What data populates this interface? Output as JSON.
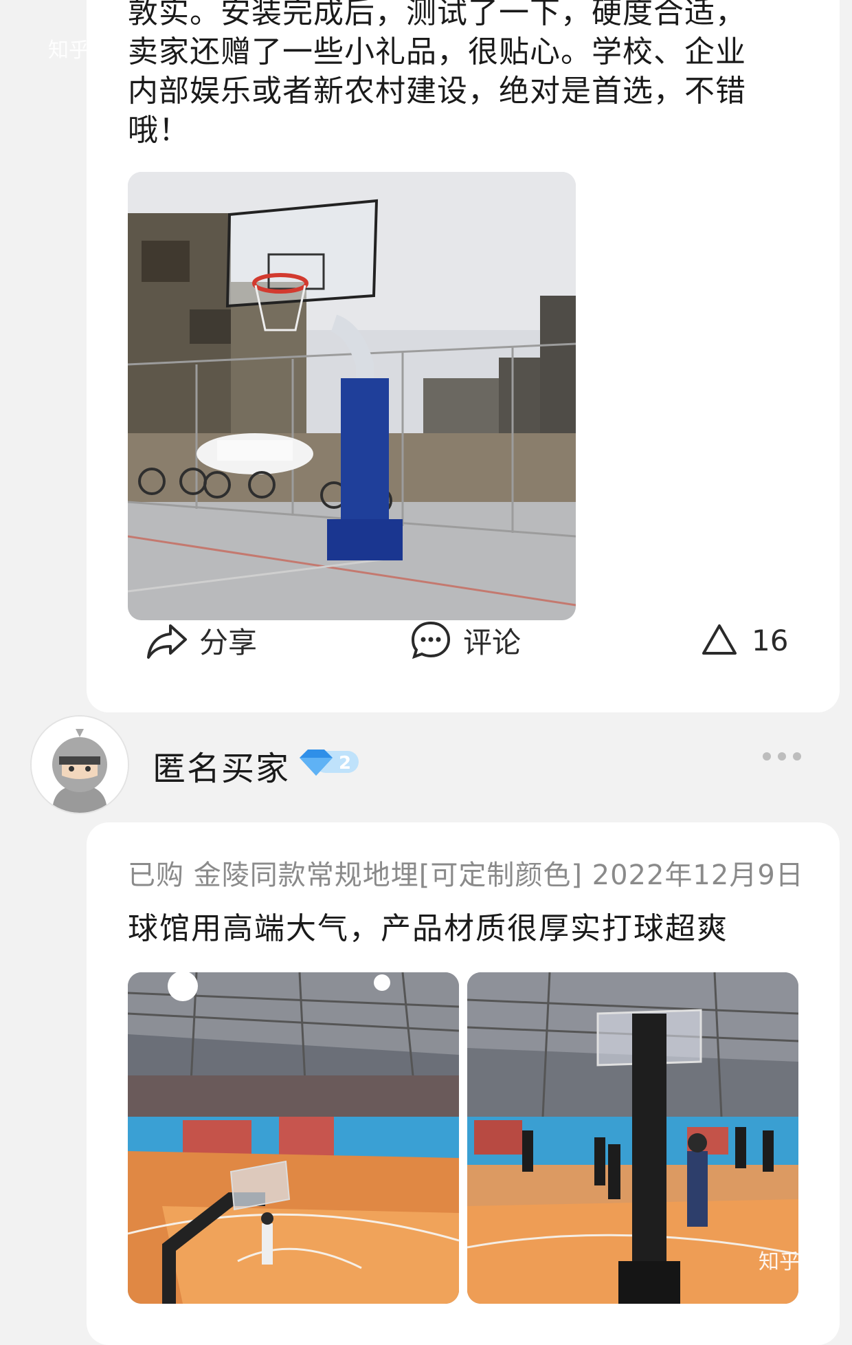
{
  "watermark": "知乎",
  "review1": {
    "lines": [
      "敦实。安装完成后，测试了一下，硬度合适，",
      "卖家还赠了一些小礼品，很贴心。学校、企业",
      "内部娱乐或者新农村建设，绝对是首选，不错",
      "哦！"
    ],
    "photo_desc": "basketball-hoop-outdoor-photo"
  },
  "actions": {
    "share_label": "分享",
    "comment_label": "评论",
    "like_count": "16",
    "share_icon": "share-icon",
    "comment_icon": "comment-icon",
    "like_icon": "triangle-like-icon"
  },
  "user": {
    "name": "匿名买家",
    "level": "2",
    "avatar_icon": "anonymous-ninja-avatar"
  },
  "review2": {
    "meta": "已购 金陵同款常规地埋[可定制颜色] 2022年12月9日",
    "text": "球馆用高端大气，产品材质很厚实打球超爽"
  },
  "colors": {
    "accent_blue": "#3aa0f0",
    "card_bg": "#ffffff",
    "page_bg": "#f2f2f2",
    "meta_gray": "#8a8a8a"
  }
}
